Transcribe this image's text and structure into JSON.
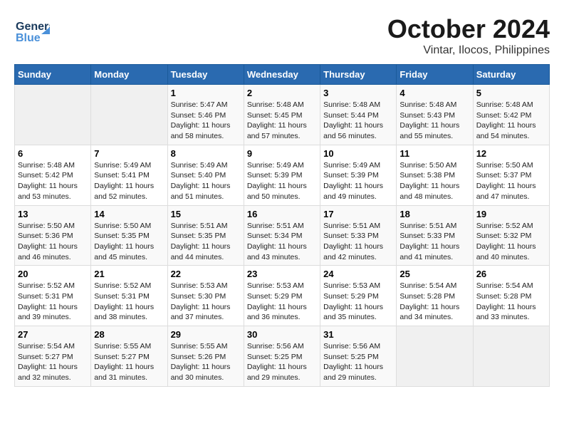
{
  "header": {
    "logo_line1": "General",
    "logo_line2": "Blue",
    "title": "October 2024",
    "subtitle": "Vintar, Ilocos, Philippines"
  },
  "days_of_week": [
    "Sunday",
    "Monday",
    "Tuesday",
    "Wednesday",
    "Thursday",
    "Friday",
    "Saturday"
  ],
  "weeks": [
    [
      {
        "day": "",
        "empty": true
      },
      {
        "day": "",
        "empty": true
      },
      {
        "day": "1",
        "sunrise": "Sunrise: 5:47 AM",
        "sunset": "Sunset: 5:46 PM",
        "daylight": "Daylight: 11 hours and 58 minutes."
      },
      {
        "day": "2",
        "sunrise": "Sunrise: 5:48 AM",
        "sunset": "Sunset: 5:45 PM",
        "daylight": "Daylight: 11 hours and 57 minutes."
      },
      {
        "day": "3",
        "sunrise": "Sunrise: 5:48 AM",
        "sunset": "Sunset: 5:44 PM",
        "daylight": "Daylight: 11 hours and 56 minutes."
      },
      {
        "day": "4",
        "sunrise": "Sunrise: 5:48 AM",
        "sunset": "Sunset: 5:43 PM",
        "daylight": "Daylight: 11 hours and 55 minutes."
      },
      {
        "day": "5",
        "sunrise": "Sunrise: 5:48 AM",
        "sunset": "Sunset: 5:42 PM",
        "daylight": "Daylight: 11 hours and 54 minutes."
      }
    ],
    [
      {
        "day": "6",
        "sunrise": "Sunrise: 5:48 AM",
        "sunset": "Sunset: 5:42 PM",
        "daylight": "Daylight: 11 hours and 53 minutes."
      },
      {
        "day": "7",
        "sunrise": "Sunrise: 5:49 AM",
        "sunset": "Sunset: 5:41 PM",
        "daylight": "Daylight: 11 hours and 52 minutes."
      },
      {
        "day": "8",
        "sunrise": "Sunrise: 5:49 AM",
        "sunset": "Sunset: 5:40 PM",
        "daylight": "Daylight: 11 hours and 51 minutes."
      },
      {
        "day": "9",
        "sunrise": "Sunrise: 5:49 AM",
        "sunset": "Sunset: 5:39 PM",
        "daylight": "Daylight: 11 hours and 50 minutes."
      },
      {
        "day": "10",
        "sunrise": "Sunrise: 5:49 AM",
        "sunset": "Sunset: 5:39 PM",
        "daylight": "Daylight: 11 hours and 49 minutes."
      },
      {
        "day": "11",
        "sunrise": "Sunrise: 5:50 AM",
        "sunset": "Sunset: 5:38 PM",
        "daylight": "Daylight: 11 hours and 48 minutes."
      },
      {
        "day": "12",
        "sunrise": "Sunrise: 5:50 AM",
        "sunset": "Sunset: 5:37 PM",
        "daylight": "Daylight: 11 hours and 47 minutes."
      }
    ],
    [
      {
        "day": "13",
        "sunrise": "Sunrise: 5:50 AM",
        "sunset": "Sunset: 5:36 PM",
        "daylight": "Daylight: 11 hours and 46 minutes."
      },
      {
        "day": "14",
        "sunrise": "Sunrise: 5:50 AM",
        "sunset": "Sunset: 5:35 PM",
        "daylight": "Daylight: 11 hours and 45 minutes."
      },
      {
        "day": "15",
        "sunrise": "Sunrise: 5:51 AM",
        "sunset": "Sunset: 5:35 PM",
        "daylight": "Daylight: 11 hours and 44 minutes."
      },
      {
        "day": "16",
        "sunrise": "Sunrise: 5:51 AM",
        "sunset": "Sunset: 5:34 PM",
        "daylight": "Daylight: 11 hours and 43 minutes."
      },
      {
        "day": "17",
        "sunrise": "Sunrise: 5:51 AM",
        "sunset": "Sunset: 5:33 PM",
        "daylight": "Daylight: 11 hours and 42 minutes."
      },
      {
        "day": "18",
        "sunrise": "Sunrise: 5:51 AM",
        "sunset": "Sunset: 5:33 PM",
        "daylight": "Daylight: 11 hours and 41 minutes."
      },
      {
        "day": "19",
        "sunrise": "Sunrise: 5:52 AM",
        "sunset": "Sunset: 5:32 PM",
        "daylight": "Daylight: 11 hours and 40 minutes."
      }
    ],
    [
      {
        "day": "20",
        "sunrise": "Sunrise: 5:52 AM",
        "sunset": "Sunset: 5:31 PM",
        "daylight": "Daylight: 11 hours and 39 minutes."
      },
      {
        "day": "21",
        "sunrise": "Sunrise: 5:52 AM",
        "sunset": "Sunset: 5:31 PM",
        "daylight": "Daylight: 11 hours and 38 minutes."
      },
      {
        "day": "22",
        "sunrise": "Sunrise: 5:53 AM",
        "sunset": "Sunset: 5:30 PM",
        "daylight": "Daylight: 11 hours and 37 minutes."
      },
      {
        "day": "23",
        "sunrise": "Sunrise: 5:53 AM",
        "sunset": "Sunset: 5:29 PM",
        "daylight": "Daylight: 11 hours and 36 minutes."
      },
      {
        "day": "24",
        "sunrise": "Sunrise: 5:53 AM",
        "sunset": "Sunset: 5:29 PM",
        "daylight": "Daylight: 11 hours and 35 minutes."
      },
      {
        "day": "25",
        "sunrise": "Sunrise: 5:54 AM",
        "sunset": "Sunset: 5:28 PM",
        "daylight": "Daylight: 11 hours and 34 minutes."
      },
      {
        "day": "26",
        "sunrise": "Sunrise: 5:54 AM",
        "sunset": "Sunset: 5:28 PM",
        "daylight": "Daylight: 11 hours and 33 minutes."
      }
    ],
    [
      {
        "day": "27",
        "sunrise": "Sunrise: 5:54 AM",
        "sunset": "Sunset: 5:27 PM",
        "daylight": "Daylight: 11 hours and 32 minutes."
      },
      {
        "day": "28",
        "sunrise": "Sunrise: 5:55 AM",
        "sunset": "Sunset: 5:27 PM",
        "daylight": "Daylight: 11 hours and 31 minutes."
      },
      {
        "day": "29",
        "sunrise": "Sunrise: 5:55 AM",
        "sunset": "Sunset: 5:26 PM",
        "daylight": "Daylight: 11 hours and 30 minutes."
      },
      {
        "day": "30",
        "sunrise": "Sunrise: 5:56 AM",
        "sunset": "Sunset: 5:25 PM",
        "daylight": "Daylight: 11 hours and 29 minutes."
      },
      {
        "day": "31",
        "sunrise": "Sunrise: 5:56 AM",
        "sunset": "Sunset: 5:25 PM",
        "daylight": "Daylight: 11 hours and 29 minutes."
      },
      {
        "day": "",
        "empty": true
      },
      {
        "day": "",
        "empty": true
      }
    ]
  ]
}
